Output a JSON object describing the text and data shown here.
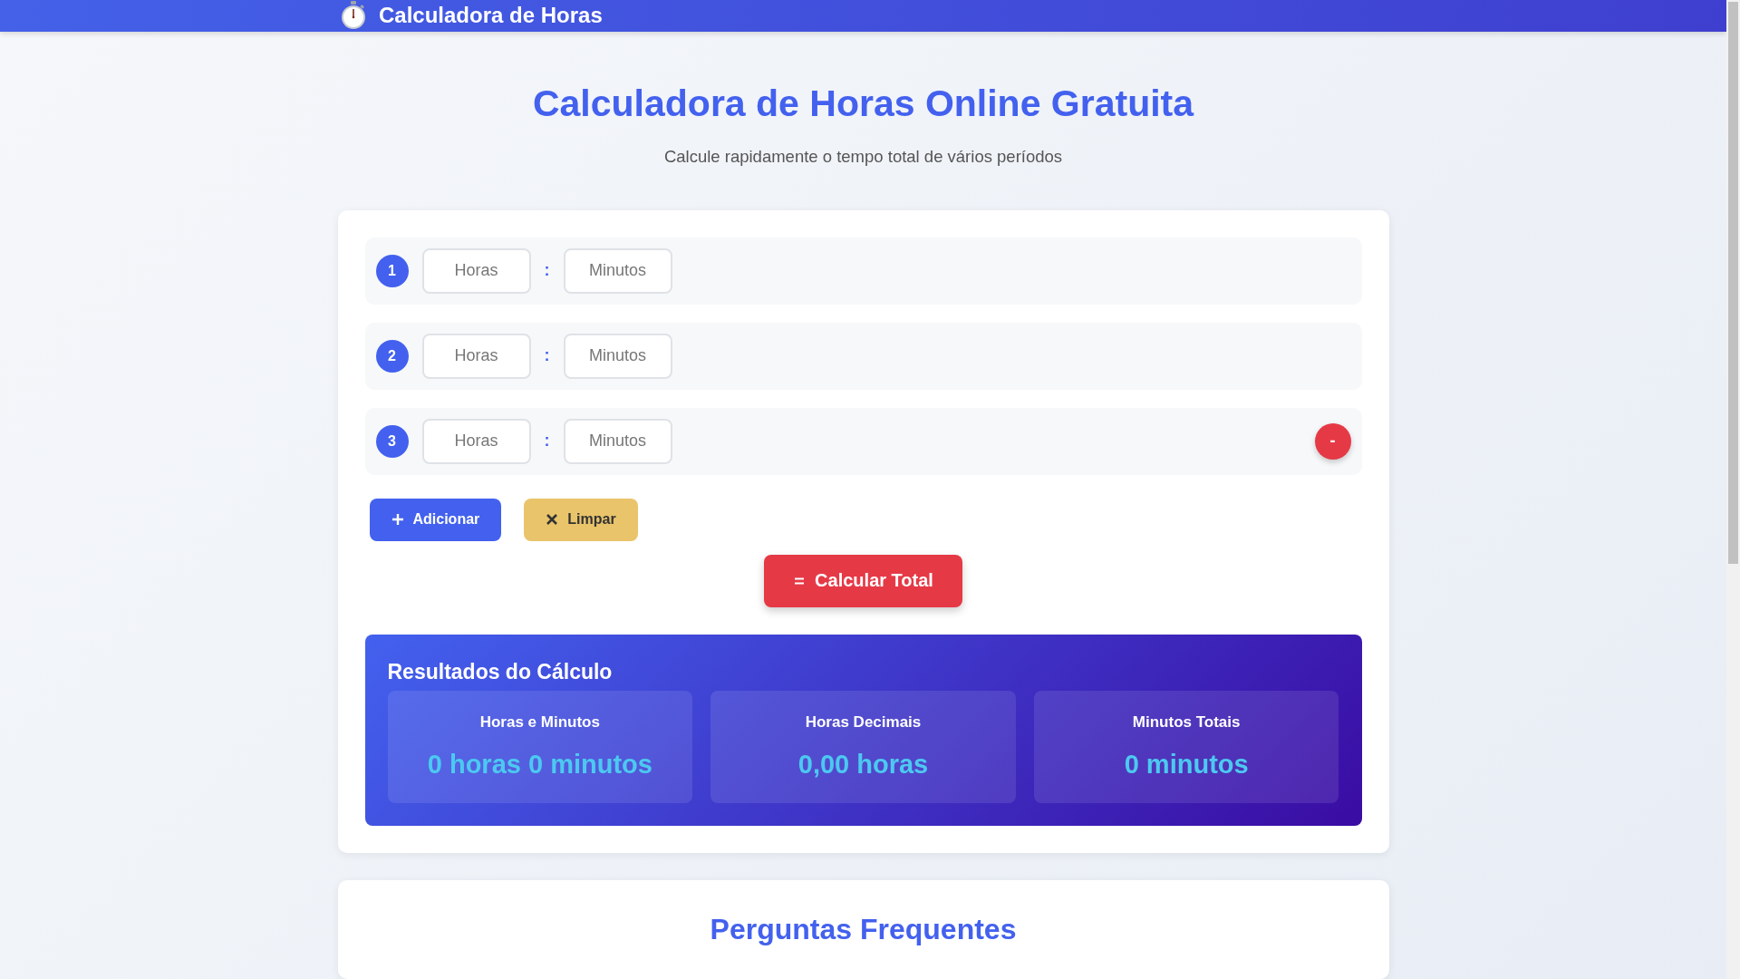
{
  "header": {
    "title": "Calculadora de Horas"
  },
  "hero": {
    "title": "Calculadora de Horas Online Gratuita",
    "subtitle": "Calcule rapidamente o tempo total de vários períodos"
  },
  "periods": [
    {
      "number": "1",
      "hours_placeholder": "Horas",
      "separator": ":",
      "minutes_placeholder": "Minutos",
      "removable": false
    },
    {
      "number": "2",
      "hours_placeholder": "Horas",
      "separator": ":",
      "minutes_placeholder": "Minutos",
      "removable": false
    },
    {
      "number": "3",
      "hours_placeholder": "Horas",
      "separator": ":",
      "minutes_placeholder": "Minutos",
      "removable": true,
      "remove_label": "-"
    }
  ],
  "actions": [
    {
      "kind": "add",
      "label": "Adicionar"
    },
    {
      "kind": "clear",
      "label": "Limpar"
    }
  ],
  "calculate": {
    "label": "Calcular Total"
  },
  "results": {
    "title": "Resultados do Cálculo",
    "cards": [
      {
        "label": "Horas e Minutos",
        "value": "0 horas 0 minutos"
      },
      {
        "label": "Horas Decimais",
        "value": "0,00 horas"
      },
      {
        "label": "Minutos Totais",
        "value": "0 minutos"
      }
    ]
  },
  "faq": {
    "title": "Perguntas Frequentes"
  }
}
